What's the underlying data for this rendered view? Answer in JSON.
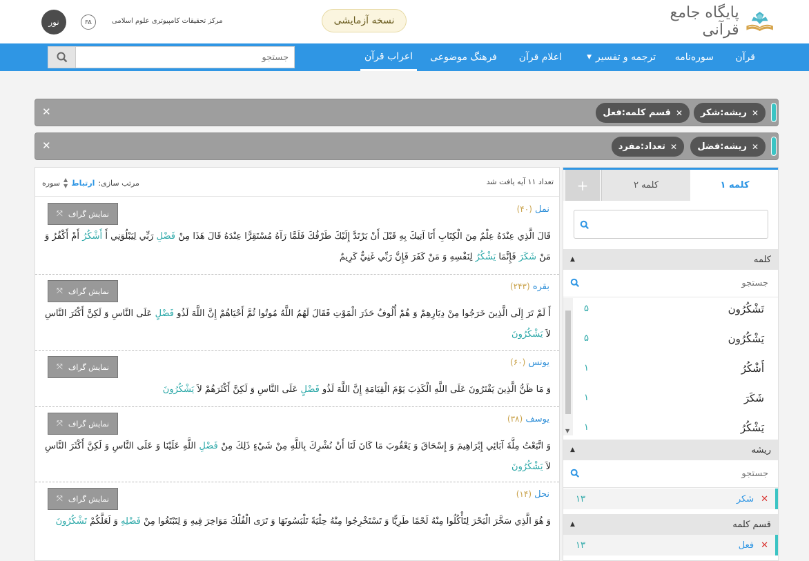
{
  "header": {
    "logo_text": "پایگاه جامع قرآنی",
    "trial_label": "نسخه آزمایشی",
    "org_name": "مرکز تحقیقات کامپیوتری علوم اسلامی",
    "lang": "FA",
    "noor_label": "نور"
  },
  "nav": {
    "items": [
      {
        "label": "قرآن"
      },
      {
        "label": "سوره‌نامه"
      },
      {
        "label": "ترجمه و تفسیر"
      },
      {
        "label": "اعلام قرآن"
      },
      {
        "label": "فرهنگ موضوعی"
      },
      {
        "label": "اعراب قرآن"
      }
    ],
    "search_placeholder": "جستجو"
  },
  "filters": [
    {
      "chips": [
        "ریشه:شکر",
        "قسم کلمه:فعل"
      ]
    },
    {
      "chips": [
        "ریشه:فضل",
        "تعداد:مفرد"
      ]
    }
  ],
  "results": {
    "count_text": "تعداد ۱۱ آیه یافت شد",
    "sort_label": "مرتب سازی:",
    "sort_active": "ارتباط",
    "sort_other": "سوره",
    "graph_label": "نمایش گراف",
    "verses": [
      {
        "surah": "نمل",
        "num": "(۴۰)",
        "text_html": "قَالَ الَّذِي عِنْدَهُ عِلْمٌ مِنَ الْكِتَابِ أَنَا آتِيكَ بِهِ قَبْلَ أَنْ يَرْتَدَّ إِلَيْكَ طَرْفُكَ فَلَمَّا رَآهُ مُسْتَقِرًّا عِنْدَهُ قَالَ هَذَا مِنْ <span class='hl'>فَضْلِ</span> رَبِّي لِيَبْلُوَنِي أَ <span class='hl'>أَشْكُرُ</span> أَمْ أَكْفُرُ وَ مَنْ <span class='hl'>شَكَرَ</span> فَإِنَّمَا <span class='hl'>يَشْكُرُ</span> لِنَفْسِهِ وَ مَنْ كَفَرَ فَإِنَّ رَبِّي غَنِيٌّ كَرِيمٌ"
      },
      {
        "surah": "بقره",
        "num": "(۲۴۳)",
        "text_html": "أَ لَمْ تَرَ إِلَى الَّذِينَ خَرَجُوا مِنْ دِيَارِهِمْ وَ هُمْ أُلُوفٌ حَذَرَ الْمَوْتِ فَقَالَ لَهُمُ اللَّهُ مُوتُوا ثُمَّ أَحْيَاهُمْ إِنَّ اللَّهَ لَذُو <span class='hl'>فَضْلٍ</span> عَلَى النَّاسِ وَ لَكِنَّ أَكْثَرَ النَّاسِ لاَ <span class='hl'>يَشْكُرُونَ</span>"
      },
      {
        "surah": "یونس",
        "num": "(۶۰)",
        "text_html": "وَ مَا ظَنُّ الَّذِينَ يَفْتَرُونَ عَلَى اللَّهِ الْكَذِبَ يَوْمَ الْقِيَامَةِ إِنَّ اللَّهَ لَذُو <span class='hl'>فَضْلٍ</span> عَلَى النَّاسِ وَ لَكِنَّ أَكْثَرَهُمْ لاَ <span class='hl'>يَشْكُرُونَ</span>"
      },
      {
        "surah": "یوسف",
        "num": "(۳۸)",
        "text_html": "وَ اتَّبَعْتُ مِلَّةَ آبَائِي إِبْرَاهِيمَ وَ إِسْحَاقَ وَ يَعْقُوبَ مَا كَانَ لَنَا أَنْ نُشْرِكَ بِاللَّهِ مِنْ شَيْءٍ ذَلِكَ مِنْ <span class='hl'>فَضْلِ</span> اللَّهِ عَلَيْنَا وَ عَلَى النَّاسِ وَ لَكِنَّ أَكْثَرَ النَّاسِ لاَ <span class='hl'>يَشْكُرُونَ</span>"
      },
      {
        "surah": "نحل",
        "num": "(۱۴)",
        "text_html": "وَ هُوَ الَّذِي سَخَّرَ الْبَحْرَ لِتَأْكُلُوا مِنْهُ لَحْمًا طَرِيًّا وَ تَسْتَخْرِجُوا مِنْهُ حِلْيَةً تَلْبَسُونَهَا وَ تَرَى الْفُلْكَ مَوَاخِرَ فِيهِ وَ لِتَبْتَغُوا مِنْ <span class='hl'>فَضْلِهِ</span> وَ لَعَلَّكُمْ <span class='hl'>تَشْكُرُونَ</span>"
      }
    ]
  },
  "side": {
    "tabs": [
      "کلمه ۱",
      "کلمه ۲",
      "+"
    ],
    "sections": {
      "word": "کلمه",
      "root": "ریشه",
      "pos": "قسم کلمه"
    },
    "search_placeholder": "جستجو",
    "words": [
      {
        "word": "تَشْكُرُون",
        "count": "۵"
      },
      {
        "word": "يَشْكُرُون",
        "count": "۵"
      },
      {
        "word": "أَشْكُرُ",
        "count": "۱"
      },
      {
        "word": "شَكَرَ",
        "count": "۱"
      },
      {
        "word": "يَشْكُرُ",
        "count": "۱"
      }
    ],
    "root_selected": {
      "name": "شکر",
      "count": "۱۳"
    },
    "pos_selected": {
      "name": "فعل",
      "count": "۱۳"
    }
  }
}
